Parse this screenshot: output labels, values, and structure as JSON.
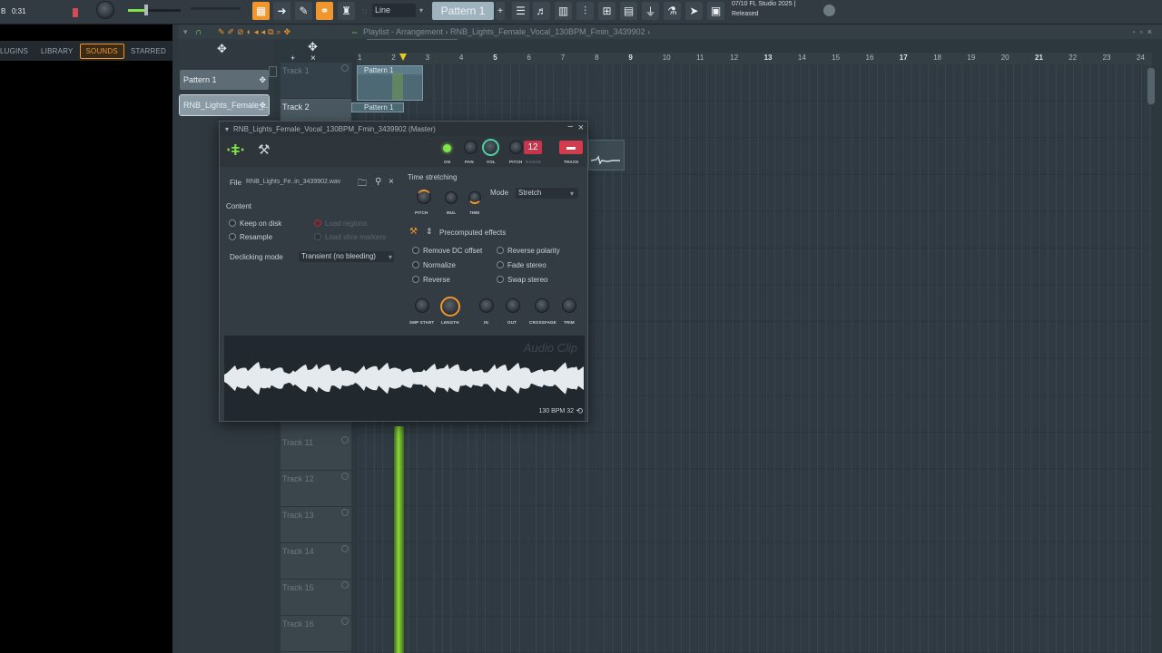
{
  "topbar": {
    "time_prefix": "B",
    "time": "0:31",
    "snap_mode": "Line",
    "pattern": "Pattern 1",
    "news_line1": "07/10  FL Studio 2025 |",
    "news_line2": "Released"
  },
  "browser": {
    "tabs": [
      "LUGINS",
      "LIBRARY",
      "SOUNDS",
      "STARRED"
    ]
  },
  "playlist": {
    "title": "Playlist - Arrangement › RNB_Lights_Female_Vocal_130BPM_Fmin_3439902 ›",
    "ruler": [
      "1",
      "2",
      "3",
      "4",
      "5",
      "6",
      "7",
      "8",
      "9",
      "10",
      "11",
      "12",
      "13",
      "14",
      "15",
      "16",
      "17",
      "18",
      "19",
      "20",
      "21",
      "22",
      "23",
      "24"
    ],
    "patterns": [
      "Pattern 1",
      "RNB_Lights_Female_..."
    ],
    "tracks": [
      "Track 1",
      "Track 2",
      "Track 11",
      "Track 12",
      "Track 13",
      "Track 14",
      "Track 15",
      "Track 16"
    ],
    "clip1": "Pattern 1",
    "clip2": "Pattern 1"
  },
  "sampler": {
    "title": "RNB_Lights_Female_Vocal_130BPM_Fmin_3439902 (Master)",
    "knob_labels": {
      "on": "ON",
      "pan": "PAN",
      "vol": "VOL",
      "pitch": "PITCH",
      "range": "RANGE",
      "track": "TRACK"
    },
    "range_value": "12",
    "file_label": "File",
    "file_name": "RNB_Lights_Fe..in_3439902.wav",
    "content_label": "Content",
    "keep_on_disk": "Keep on disk",
    "resample": "Resample",
    "load_regions": "Load regions",
    "load_slice": "Load slice markers",
    "declicking_label": "Declicking mode",
    "declicking_value": "Transient (no bleeding)",
    "time_stretching": "Time stretching",
    "ts_knobs": [
      "PITCH",
      "MUL",
      "TIME"
    ],
    "mode_label": "Mode",
    "mode_value": "Stretch",
    "precomputed": "Precomputed effects",
    "effects_left": [
      "Remove DC offset",
      "Normalize",
      "Reverse"
    ],
    "effects_right": [
      "Reverse polarity",
      "Fade stereo",
      "Swap stereo"
    ],
    "fx_knobs": [
      "SMP START",
      "LENGTH",
      "IN",
      "OUT",
      "CROSSFADE",
      "TRIM"
    ],
    "wave_watermark": "Audio Clip",
    "bpm_text": "130 BPM 32"
  },
  "colors": {
    "accent": "#f0962d",
    "led": "#7fe64a",
    "playhead": "#8cd93b"
  }
}
